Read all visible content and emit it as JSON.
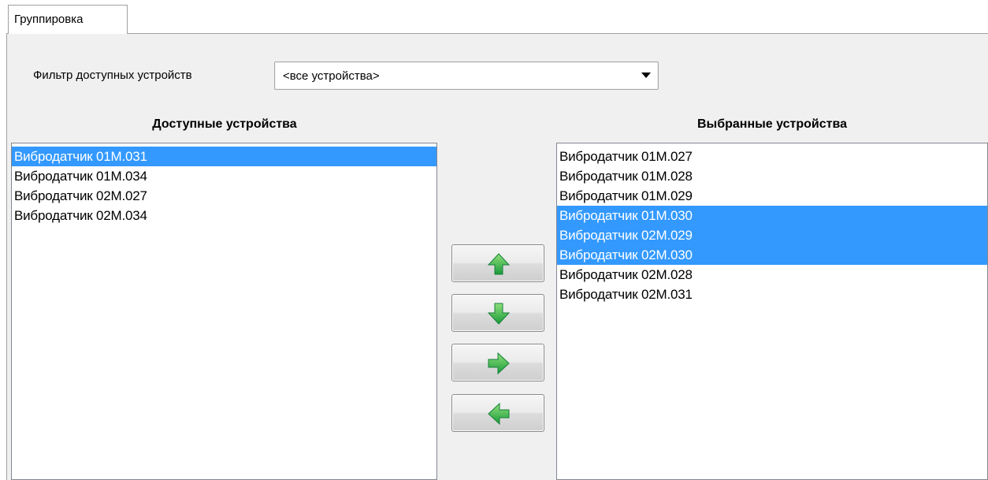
{
  "tab": {
    "label": "Группировка"
  },
  "filter": {
    "label": "Фильтр доступных устройств",
    "selected": "<все устройства>"
  },
  "available": {
    "title": "Доступные устройства",
    "items": [
      {
        "label": "Вибродатчик 01М.031",
        "selected": true
      },
      {
        "label": "Вибродатчик 01М.034",
        "selected": false
      },
      {
        "label": "Вибродатчик 02М.027",
        "selected": false
      },
      {
        "label": "Вибродатчик 02М.034",
        "selected": false
      }
    ]
  },
  "chosen": {
    "title": "Выбранные устройства",
    "items": [
      {
        "label": "Вибродатчик 01М.027",
        "selected": false
      },
      {
        "label": "Вибродатчик 01М.028",
        "selected": false
      },
      {
        "label": "Вибродатчик 01М.029",
        "selected": false
      },
      {
        "label": "Вибродатчик 01М.030",
        "selected": true
      },
      {
        "label": "Вибродатчик 02М.029",
        "selected": true
      },
      {
        "label": "Вибродатчик 02М.030",
        "selected": true
      },
      {
        "label": "Вибродатчик 02М.028",
        "selected": false
      },
      {
        "label": "Вибродатчик 02М.031",
        "selected": false
      }
    ]
  },
  "buttons": [
    {
      "name": "move-up-button",
      "icon": "arrow-up-icon"
    },
    {
      "name": "move-down-button",
      "icon": "arrow-down-icon"
    },
    {
      "name": "add-to-selected-button",
      "icon": "arrow-right-icon"
    },
    {
      "name": "remove-from-selected-button",
      "icon": "arrow-left-icon"
    }
  ],
  "colors": {
    "selection": "#3399ff",
    "arrow_green": "#2fb34a",
    "panel_bg": "#f0f0f0"
  }
}
